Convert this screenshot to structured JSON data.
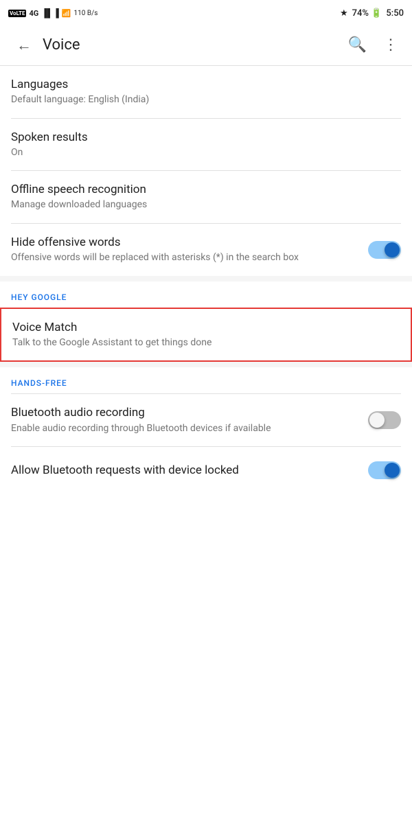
{
  "statusBar": {
    "left": {
      "volte": "VoLTE",
      "network": "4G",
      "speed": "110 B/s"
    },
    "right": {
      "bluetooth": "bluetooth",
      "battery": "74",
      "time": "5:50"
    }
  },
  "toolbar": {
    "title": "Voice",
    "backIcon": "←",
    "searchIcon": "🔍",
    "moreIcon": "⋮"
  },
  "sections": {
    "languages": {
      "title": "Languages",
      "subtitle": "Default language: English (India)"
    },
    "spokenResults": {
      "title": "Spoken results",
      "subtitle": "On"
    },
    "offlineSpeech": {
      "title": "Offline speech recognition",
      "subtitle": "Manage downloaded languages"
    },
    "hideOffensive": {
      "title": "Hide offensive words",
      "subtitle": "Offensive words will be replaced with asterisks (*) in the search box",
      "toggle": "on"
    },
    "heyGoogle": {
      "sectionLabel": "HEY GOOGLE",
      "voiceMatch": {
        "title": "Voice Match",
        "subtitle": "Talk to the Google Assistant to get things done"
      }
    },
    "handsFree": {
      "sectionLabel": "HANDS-FREE",
      "bluetoothRecording": {
        "title": "Bluetooth audio recording",
        "subtitle": "Enable audio recording through Bluetooth devices if available",
        "toggle": "off"
      },
      "bluetoothRequests": {
        "title": "Allow Bluetooth requests with device locked",
        "toggle": "on"
      }
    }
  }
}
